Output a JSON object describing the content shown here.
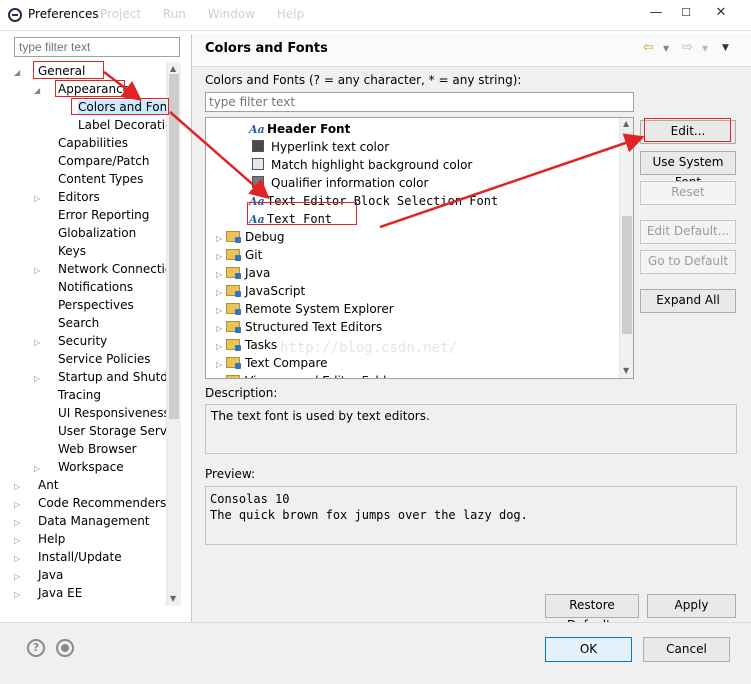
{
  "window": {
    "title": "Preferences",
    "ghost_menu": "Project Run Window Help",
    "min": "—",
    "max": "☐",
    "close": "✕"
  },
  "left": {
    "filter_placeholder": "type filter text",
    "tree": [
      {
        "label": "General",
        "indent": 0,
        "tri": "◢"
      },
      {
        "label": "Appearance",
        "indent": 1,
        "tri": "◢"
      },
      {
        "label": "Colors and Fonts",
        "indent": 2,
        "tri": ""
      },
      {
        "label": "Label Decorations",
        "indent": 2,
        "tri": ""
      },
      {
        "label": "Capabilities",
        "indent": 1,
        "tri": ""
      },
      {
        "label": "Compare/Patch",
        "indent": 1,
        "tri": ""
      },
      {
        "label": "Content Types",
        "indent": 1,
        "tri": ""
      },
      {
        "label": "Editors",
        "indent": 1,
        "tri": "▷"
      },
      {
        "label": "Error Reporting",
        "indent": 1,
        "tri": ""
      },
      {
        "label": "Globalization",
        "indent": 1,
        "tri": ""
      },
      {
        "label": "Keys",
        "indent": 1,
        "tri": ""
      },
      {
        "label": "Network Connections",
        "indent": 1,
        "tri": "▷"
      },
      {
        "label": "Notifications",
        "indent": 1,
        "tri": ""
      },
      {
        "label": "Perspectives",
        "indent": 1,
        "tri": ""
      },
      {
        "label": "Search",
        "indent": 1,
        "tri": ""
      },
      {
        "label": "Security",
        "indent": 1,
        "tri": "▷"
      },
      {
        "label": "Service Policies",
        "indent": 1,
        "tri": ""
      },
      {
        "label": "Startup and Shutdown",
        "indent": 1,
        "tri": "▷"
      },
      {
        "label": "Tracing",
        "indent": 1,
        "tri": ""
      },
      {
        "label": "UI Responsiveness Monitoring",
        "indent": 1,
        "tri": ""
      },
      {
        "label": "User Storage Service",
        "indent": 1,
        "tri": ""
      },
      {
        "label": "Web Browser",
        "indent": 1,
        "tri": ""
      },
      {
        "label": "Workspace",
        "indent": 1,
        "tri": "▷"
      },
      {
        "label": "Ant",
        "indent": 0,
        "tri": "▷"
      },
      {
        "label": "Code Recommenders",
        "indent": 0,
        "tri": "▷"
      },
      {
        "label": "Data Management",
        "indent": 0,
        "tri": "▷"
      },
      {
        "label": "Help",
        "indent": 0,
        "tri": "▷"
      },
      {
        "label": "Install/Update",
        "indent": 0,
        "tri": "▷"
      },
      {
        "label": "Java",
        "indent": 0,
        "tri": "▷"
      },
      {
        "label": "Java EE",
        "indent": 0,
        "tri": "▷"
      }
    ]
  },
  "main": {
    "title": "Colors and Fonts",
    "hint": "Colors and Fonts (? = any character, * = any string):",
    "filter_placeholder": "type filter text",
    "items": [
      {
        "kind": "font",
        "label": "Header Font",
        "bold": true
      },
      {
        "kind": "color",
        "label": "Hyperlink text color",
        "swatch": "#4a4a4a"
      },
      {
        "kind": "color",
        "label": "Match highlight background color",
        "swatch": "#e0e7ef"
      },
      {
        "kind": "color",
        "label": "Qualifier information color",
        "swatch": "#7a7a7a"
      },
      {
        "kind": "font",
        "label": "Text Editor Block Selection Font",
        "mono": true
      },
      {
        "kind": "font",
        "label": "Text Font",
        "mono": true
      },
      {
        "kind": "group",
        "label": "Debug"
      },
      {
        "kind": "group",
        "label": "Git"
      },
      {
        "kind": "group",
        "label": "Java"
      },
      {
        "kind": "group",
        "label": "JavaScript"
      },
      {
        "kind": "group",
        "label": "Remote System Explorer"
      },
      {
        "kind": "group",
        "label": "Structured Text Editors"
      },
      {
        "kind": "group",
        "label": "Tasks"
      },
      {
        "kind": "group",
        "label": "Text Compare"
      },
      {
        "kind": "group",
        "label": "Viewers and Editor Folders"
      }
    ],
    "buttons": {
      "edit": "Edit...",
      "use_system_font": "Use System Font",
      "reset": "Reset",
      "edit_default": "Edit Default...",
      "go_to_default": "Go to Default",
      "expand_all": "Expand All"
    },
    "description_label": "Description:",
    "description": "The text font is used by text editors.",
    "preview_label": "Preview:",
    "preview_line1": "Consolas 10",
    "preview_line2": "The quick brown fox jumps over the lazy dog.",
    "restore_defaults": "Restore Defaults",
    "apply": "Apply",
    "watermark": "http://blog.csdn.net/"
  },
  "footer": {
    "ok": "OK",
    "cancel": "Cancel",
    "help_icon": "?"
  },
  "colors": {
    "annotation_red": "#e02424",
    "link_blue": "#2a5db0",
    "folder_yellow": "#e8c35a"
  }
}
